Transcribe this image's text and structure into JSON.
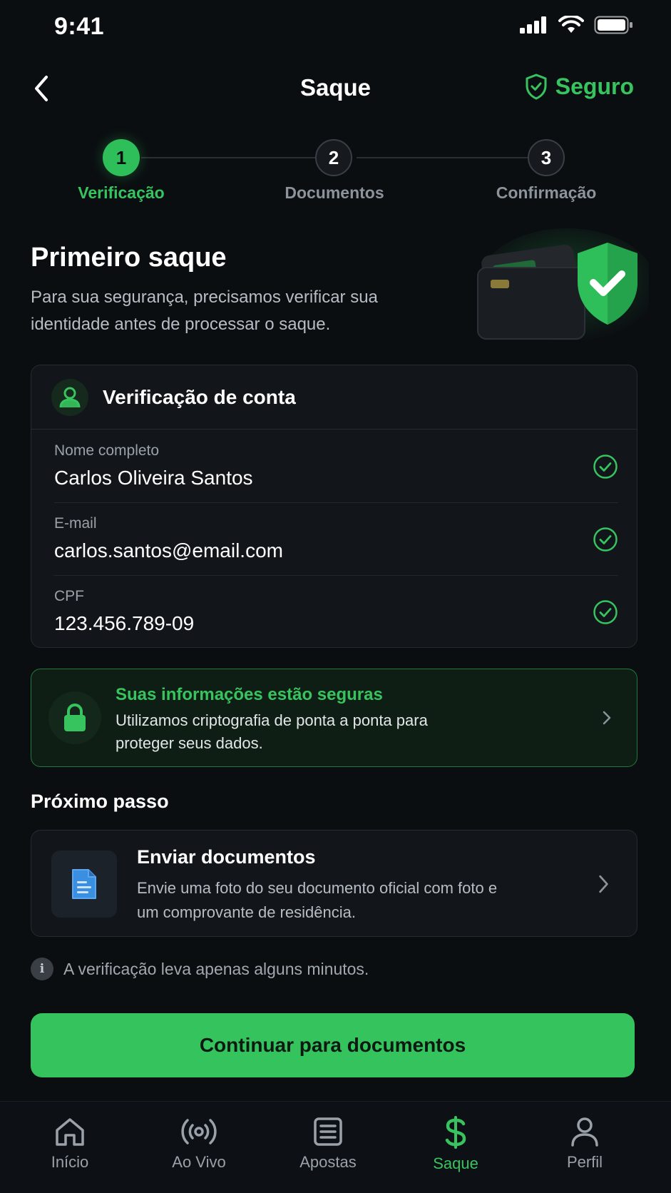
{
  "status_bar": {
    "time": "9:41"
  },
  "header": {
    "title": "Saque",
    "secure_label": "Seguro"
  },
  "stepper": {
    "steps": [
      {
        "number": "1",
        "label": "Verificação",
        "state": "active"
      },
      {
        "number": "2",
        "label": "Documentos",
        "state": "inactive"
      },
      {
        "number": "3",
        "label": "Confirmação",
        "state": "inactive"
      }
    ]
  },
  "intro": {
    "title": "Primeiro saque",
    "description": "Para sua segurança, precisamos verificar sua identidade antes de processar o saque."
  },
  "account_card": {
    "title": "Verificação de conta",
    "fields": [
      {
        "label": "Nome completo",
        "value": "Carlos Oliveira Santos",
        "verified": true
      },
      {
        "label": "E-mail",
        "value": "carlos.santos@email.com",
        "verified": true
      },
      {
        "label": "CPF",
        "value": "123.456.789-09",
        "verified": true
      }
    ]
  },
  "security_notice": {
    "title": "Suas informações estão seguras",
    "description": "Utilizamos criptografia de ponta a ponta para proteger seus dados."
  },
  "next_step": {
    "heading": "Próximo passo",
    "title": "Enviar documentos",
    "description": "Envie uma foto do seu documento oficial com foto e um comprovante de residência."
  },
  "info": {
    "icon_text": "i",
    "text": "A verificação leva apenas alguns minutos."
  },
  "cta": {
    "label": "Continuar para documentos"
  },
  "bottom_nav": {
    "items": [
      {
        "label": "Início",
        "icon": "home-icon",
        "active": false
      },
      {
        "label": "Ao Vivo",
        "icon": "live-broadcast-icon",
        "active": false
      },
      {
        "label": "Apostas",
        "icon": "bets-list-icon",
        "active": false
      },
      {
        "label": "Saque",
        "icon": "dollar-icon",
        "active": true
      },
      {
        "label": "Perfil",
        "icon": "profile-icon",
        "active": false
      }
    ]
  },
  "colors": {
    "accent": "#37c45f",
    "background": "#0b0e11",
    "card": "#12161b",
    "doc_icon": "#3b8fe0"
  }
}
